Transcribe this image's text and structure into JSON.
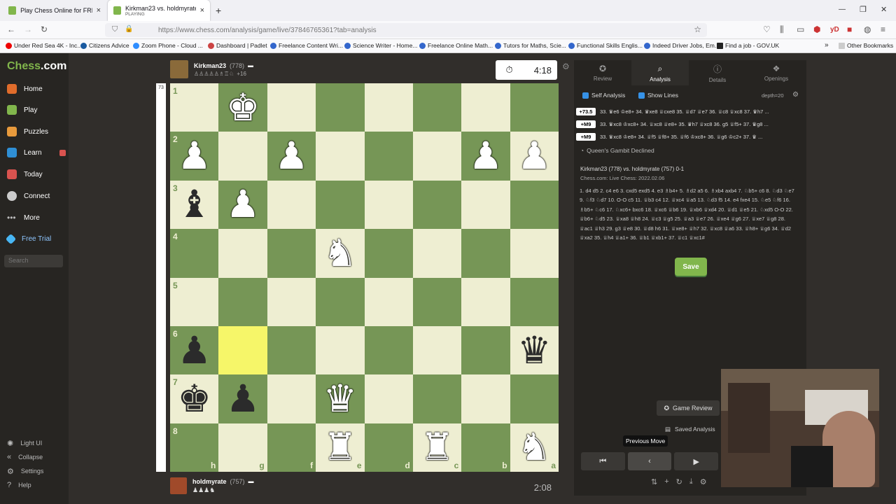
{
  "browser": {
    "tabs": [
      {
        "title": "Play Chess Online for FREE with",
        "close": "×"
      },
      {
        "title": "Kirkman23 vs. holdmyrate | Ana",
        "subtitle": "PLAYING",
        "close": "×"
      }
    ],
    "new_tab": "+",
    "window_controls": [
      "—",
      "❐",
      "✕"
    ],
    "url": "https://www.chess.com/analysis/game/live/37846765361?tab=analysis",
    "bookmarks": [
      "Under Red Sea 4K - Inc...",
      "Citizens Advice",
      "Zoom Phone - Cloud ...",
      "Dashboard | Padlet",
      "Freelance Content Wri...",
      "Science Writer - Home...",
      "Freelance Online Math...",
      "Tutors for Maths, Scie...",
      "Functional Skills Englis...",
      "Indeed Driver Jobs, Em...",
      "Find a job - GOV.UK"
    ],
    "other_bookmarks": "Other Bookmarks",
    "toolbar_text": "yD"
  },
  "sidebar": {
    "logo_a": "Chess",
    "logo_b": ".com",
    "items": [
      "Home",
      "Play",
      "Puzzles",
      "Learn",
      "Today",
      "Connect",
      "More"
    ],
    "free_trial": "Free Trial",
    "search_placeholder": "Search",
    "footer": [
      "Light UI",
      "Collapse",
      "Settings",
      "Help"
    ]
  },
  "game": {
    "top_player": {
      "name": "Kirkman23",
      "rating": "(778)",
      "material": "+16"
    },
    "top_clock": "4:18",
    "bottom_player": {
      "name": "holdmyrate",
      "rating": "(757)"
    },
    "bottom_clock": "2:08",
    "eval_text": "73"
  },
  "board": {
    "ranks": [
      "1",
      "2",
      "3",
      "4",
      "5",
      "6",
      "7",
      "8"
    ],
    "files": [
      "h",
      "g",
      "f",
      "e",
      "d",
      "c",
      "b",
      "a"
    ],
    "rows": [
      [
        "",
        "wK",
        "",
        "",
        "",
        "",
        "",
        ""
      ],
      [
        "wP",
        "",
        "wP",
        "",
        "",
        "",
        "wP",
        "wP"
      ],
      [
        "bB",
        "wP",
        "",
        "",
        "",
        "",
        "",
        ""
      ],
      [
        "",
        "",
        "",
        "wN",
        "",
        "",
        "",
        ""
      ],
      [
        "",
        "",
        "",
        "",
        "",
        "",
        "",
        ""
      ],
      [
        "bP",
        "HL",
        "",
        "",
        "",
        "",
        "",
        "bQ"
      ],
      [
        "bK",
        "bP",
        "",
        "wQ",
        "",
        "",
        "",
        ""
      ],
      [
        "",
        "",
        "",
        "wR",
        "",
        "wR",
        "",
        "wN"
      ]
    ]
  },
  "panel": {
    "tabs": [
      "Review",
      "Analysis",
      "Details",
      "Openings"
    ],
    "self_analysis": "Self Analysis",
    "show_lines": "Show Lines",
    "depth": "depth=20",
    "lines": [
      {
        "eval": "+73.5",
        "text": "33. ♛e6 ♔e8+ 34. ♛xe8 ♕cxe8 35. ♕d7 ♕e7 36. ♕c8 ♕xc8 37. ♛h7 ..."
      },
      {
        "eval": "+M9",
        "text": "33. ♛xc8 ♔xc8+ 34. ♕xc8 ♕e8+ 35. ♛h7 ♕xc8 36. g5 ♕f5+ 37. ♛g8 ..."
      },
      {
        "eval": "+M9",
        "text": "33. ♛xc8 ♔e8+ 34. ♕f5 ♕f8+ 35. ♕f6 ♔xc8+ 36. ♕g6 ♔c2+ 37. ♛ ..."
      }
    ],
    "opening": "Queen's Gambit Declined",
    "header_line1": "Kirkman23 (778) vs. holdmyrate (757) 0-1",
    "header_line2": "Chess.com: Live Chess: 2022.02.06",
    "moves": "1. d4 d5 2. c4 e6 3. cxd5 exd5 4. e3 ♗b4+ 5. ♗d2 a5 6. ♗xb4 axb4 7. ♘b5+ c6 8. ♘d3 ♘e7 9. ♘f3 ♘d7 10. O-O c5 11. ♕b3 c4 12. ♕xc4 ♕a5 13. ♘d3 f5 14. e4 fxe4 15. ♘e5 ♘f6 16. ♗b5+ ♘c6 17. ♘xc6+ bxc6 18. ♕xc6 ♕b6 19. ♕xb6 ♕xd4 20. ♕d1 ♕e5 21. ♘xd5 O-O 22. ♕b6+ ♘d5 23. ♕xa8 ♕h8 24. ♕c3 ♕g5 25. ♕a3 ♕e7 26. ♕xe4 ♕g6 27. ♕xe7 ♕g8 28. ♕ac1 ♕h3 29. g3 ♕e8 30. ♕d8 h6 31. ♕xe8+ ♕h7 32. ♕xc8 ♕a6 33. ♕h8+ ♕g6 34. ♕d2 ♕xa2 35. ♕h4 ♕a1+ 36. ♕b1 ♕xb1+ 37. ♕c1 ♕xc1#",
    "save": "Save",
    "game_review": "Game Review",
    "saved_analysis": "Saved Analysis",
    "controls": [
      "⏮",
      "‹",
      "▶"
    ],
    "tooltip": "Previous Move"
  },
  "colors": {
    "light_square": "#eeeed2",
    "dark_square": "#769656",
    "highlight": "#f6f669",
    "accent": "#81b64c"
  }
}
